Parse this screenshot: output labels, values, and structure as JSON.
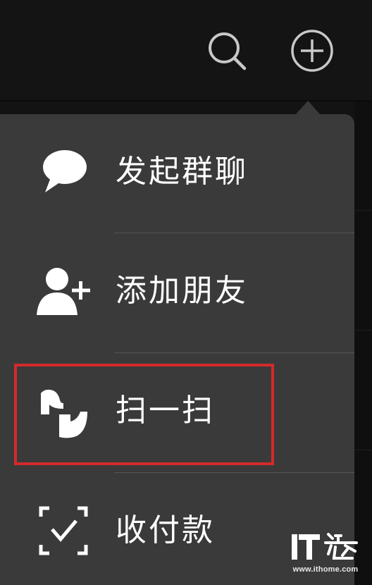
{
  "header": {
    "search_icon": "search-icon",
    "add_icon": "plus-circle-icon"
  },
  "menu": {
    "items": [
      {
        "label": "发起群聊",
        "icon": "chat-bubble-icon"
      },
      {
        "label": "添加朋友",
        "icon": "add-person-icon"
      },
      {
        "label": "扫一扫",
        "icon": "scan-icon"
      },
      {
        "label": "收付款",
        "icon": "payment-check-icon"
      }
    ],
    "highlighted_item": "扫一扫"
  },
  "watermark": {
    "logo_text": "IT之家",
    "url": "www.ithome.com"
  },
  "colors": {
    "background": "#131313",
    "menu_background": "#3a3a3a",
    "text": "#ffffff",
    "highlight_border": "#d42a2a"
  }
}
